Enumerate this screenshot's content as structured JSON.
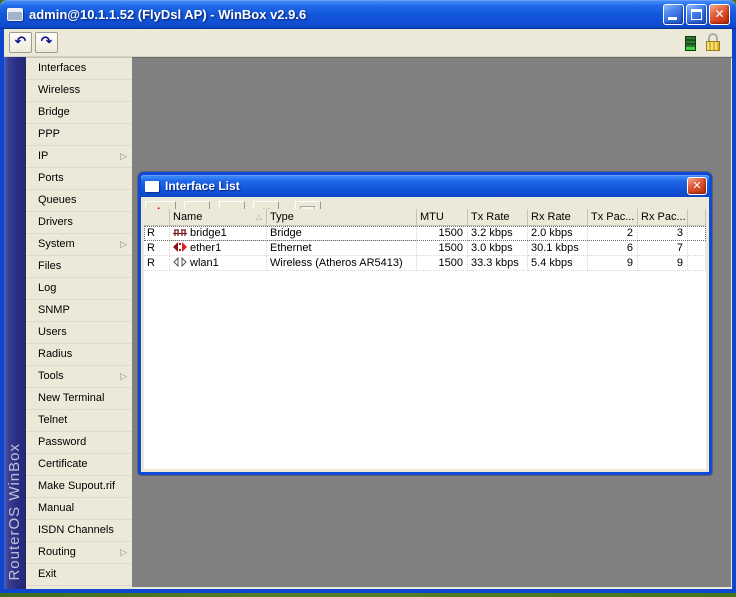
{
  "window": {
    "title": "admin@10.1.1.52 (FlyDsl AP) - WinBox v2.9.6"
  },
  "icons": {
    "undo": "↶",
    "redo": "↷",
    "close_glyph": "✕",
    "add": "+",
    "add_caret": "▾",
    "remove": "−",
    "enable": "✔",
    "disable": "✖",
    "sort_asc": "△",
    "submenu_arrow": "▷"
  },
  "colors": {
    "titlebar_blue": "#1152D8",
    "window_border_blue": "#0D47CF",
    "panel_cream": "#ECE9D8",
    "mdi_gray": "#808080",
    "sidebar_navy": "#2A3086",
    "accent_red": "#D40000",
    "desktop_green": "#46741F"
  },
  "sidebar": {
    "brand": "RouterOS WinBox",
    "items": [
      {
        "label": "Interfaces",
        "has_submenu": false
      },
      {
        "label": "Wireless",
        "has_submenu": false
      },
      {
        "label": "Bridge",
        "has_submenu": false
      },
      {
        "label": "PPP",
        "has_submenu": false
      },
      {
        "label": "IP",
        "has_submenu": true
      },
      {
        "label": "Ports",
        "has_submenu": false
      },
      {
        "label": "Queues",
        "has_submenu": false
      },
      {
        "label": "Drivers",
        "has_submenu": false
      },
      {
        "label": "System",
        "has_submenu": true
      },
      {
        "label": "Files",
        "has_submenu": false
      },
      {
        "label": "Log",
        "has_submenu": false
      },
      {
        "label": "SNMP",
        "has_submenu": false
      },
      {
        "label": "Users",
        "has_submenu": false
      },
      {
        "label": "Radius",
        "has_submenu": false
      },
      {
        "label": "Tools",
        "has_submenu": true
      },
      {
        "label": "New Terminal",
        "has_submenu": false
      },
      {
        "label": "Telnet",
        "has_submenu": false
      },
      {
        "label": "Password",
        "has_submenu": false
      },
      {
        "label": "Certificate",
        "has_submenu": false
      },
      {
        "label": "Make Supout.rif",
        "has_submenu": false
      },
      {
        "label": "Manual",
        "has_submenu": false
      },
      {
        "label": "ISDN Channels",
        "has_submenu": false
      },
      {
        "label": "Routing",
        "has_submenu": true
      },
      {
        "label": "Exit",
        "has_submenu": false
      }
    ]
  },
  "interface_list": {
    "title": "Interface List",
    "table": {
      "headers": [
        "",
        "Name",
        "Type",
        "MTU",
        "Tx Rate",
        "Rx Rate",
        "Tx Pac...",
        "Rx Pac...",
        ""
      ],
      "sort_column": "Name",
      "rows": [
        {
          "flag": "R",
          "icon": "bridge-icon",
          "name": "bridge1",
          "type": "Bridge",
          "mtu": "1500",
          "tx_rate": "3.2 kbps",
          "rx_rate": "2.0 kbps",
          "tx_pac": "2",
          "rx_pac": "3",
          "selected": true
        },
        {
          "flag": "R",
          "icon": "ethernet-icon",
          "name": "ether1",
          "type": "Ethernet",
          "mtu": "1500",
          "tx_rate": "3.0 kbps",
          "rx_rate": "30.1 kbps",
          "tx_pac": "6",
          "rx_pac": "7",
          "selected": false
        },
        {
          "flag": "R",
          "icon": "wireless-icon",
          "name": "wlan1",
          "type": "Wireless (Atheros AR5413)",
          "mtu": "1500",
          "tx_rate": "33.3 kbps",
          "rx_rate": "5.4 kbps",
          "tx_pac": "9",
          "rx_pac": "9",
          "selected": false
        }
      ]
    }
  }
}
